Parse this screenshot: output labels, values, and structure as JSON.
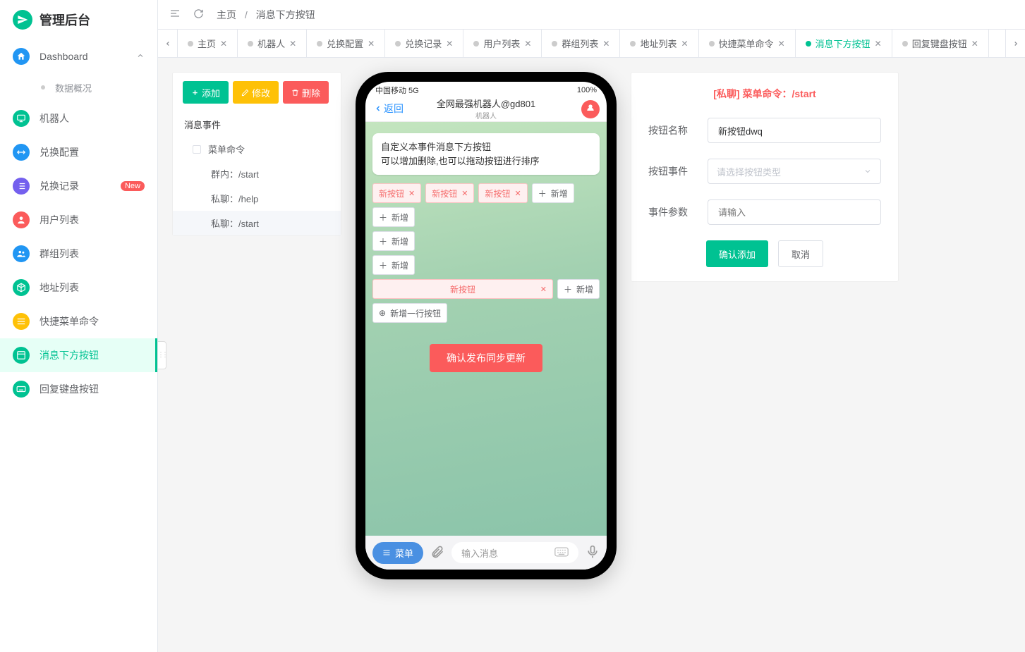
{
  "app": {
    "title": "管理后台"
  },
  "sidebar": {
    "items": [
      {
        "id": "dashboard",
        "label": "Dashboard",
        "icon": "home",
        "color": "#2196f3",
        "expandable": true,
        "expanded": true,
        "children": [
          {
            "label": "数据概况"
          }
        ]
      },
      {
        "id": "robots",
        "label": "机器人",
        "icon": "monitor",
        "color": "#00c292"
      },
      {
        "id": "exchange-config",
        "label": "兑换配置",
        "icon": "swap",
        "color": "#2196f3"
      },
      {
        "id": "exchange-record",
        "label": "兑换记录",
        "icon": "list",
        "color": "#7460ee",
        "badge": "New"
      },
      {
        "id": "users",
        "label": "用户列表",
        "icon": "user",
        "color": "#fb5b5b"
      },
      {
        "id": "groups",
        "label": "群组列表",
        "icon": "users",
        "color": "#2196f3"
      },
      {
        "id": "addresses",
        "label": "地址列表",
        "icon": "box",
        "color": "#00c292"
      },
      {
        "id": "shortcut",
        "label": "快捷菜单命令",
        "icon": "menu",
        "color": "#fec107"
      },
      {
        "id": "msg-buttons",
        "label": "消息下方按钮",
        "icon": "layout",
        "color": "#00c292",
        "active": true
      },
      {
        "id": "reply-kbd",
        "label": "回复键盘按钮",
        "icon": "keyboard",
        "color": "#00c292"
      }
    ]
  },
  "breadcrumb": {
    "home": "主页",
    "sep": "/",
    "current": "消息下方按钮"
  },
  "tabs": [
    {
      "label": "主页"
    },
    {
      "label": "机器人"
    },
    {
      "label": "兑换配置"
    },
    {
      "label": "兑换记录"
    },
    {
      "label": "用户列表"
    },
    {
      "label": "群组列表"
    },
    {
      "label": "地址列表"
    },
    {
      "label": "快捷菜单命令"
    },
    {
      "label": "消息下方按钮",
      "active": true
    },
    {
      "label": "回复键盘按钮"
    }
  ],
  "toolbar": {
    "add": "添加",
    "edit": "修改",
    "delete": "删除"
  },
  "tree": {
    "root": "消息事件",
    "group1": "菜单命令",
    "items": [
      {
        "label": "群内：/start"
      },
      {
        "label": "私聊：/help"
      },
      {
        "label": "私聊：/start",
        "selected": true
      }
    ]
  },
  "phone": {
    "status_left": "中国移动 5G",
    "status_right": "100%",
    "back": "返回",
    "title": "全网最强机器人@gd801",
    "subtitle": "机器人",
    "bubble_line1": "自定义本事件消息下方按钮",
    "bubble_line2": "可以增加删除,也可以拖动按钮进行排序",
    "chip_new": "新按钮",
    "chip_add": "新增",
    "chip_add_row": "新增一行按钮",
    "publish": "确认发布同步更新",
    "menu_pill": "菜单",
    "input_placeholder": "输入消息"
  },
  "form": {
    "title": "[私聊]   菜单命令：/start",
    "name_label": "按钮名称",
    "name_value": "新按钮dwq",
    "event_label": "按钮事件",
    "event_placeholder": "请选择按钮类型",
    "param_label": "事件参数",
    "param_placeholder": "请输入",
    "confirm": "确认添加",
    "cancel": "取消"
  }
}
